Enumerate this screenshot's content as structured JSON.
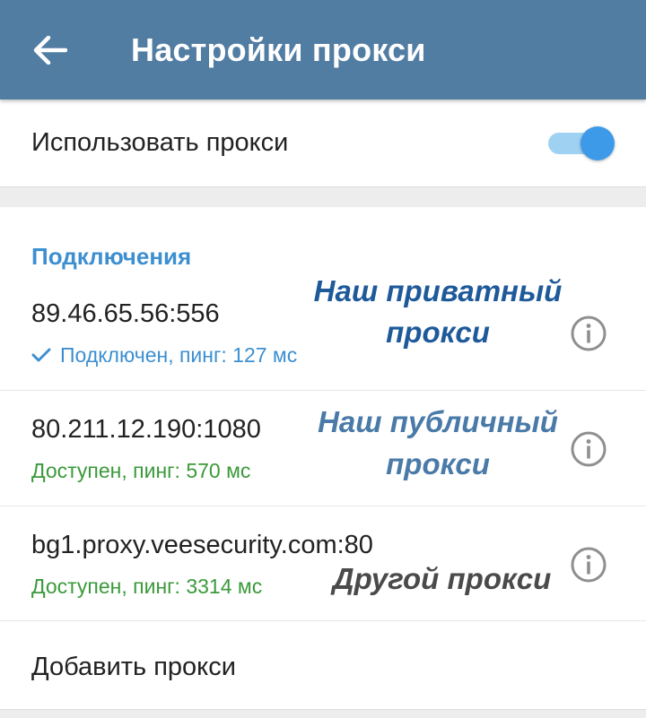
{
  "appbar": {
    "title": "Настройки прокси",
    "back_icon": "arrow-left-icon"
  },
  "use_proxy": {
    "label": "Использовать прокси",
    "enabled": true
  },
  "connections": {
    "header": "Подключения",
    "items": [
      {
        "address": "89.46.65.56:556",
        "status": "Подключен, пинг: 127 мс",
        "status_color": "#3d8fd0",
        "connected": true
      },
      {
        "address": "80.211.12.190:1080",
        "status": "Доступен, пинг: 570 мс",
        "status_color": "#3a9a3a",
        "connected": false
      },
      {
        "address": "bg1.proxy.veesecurity.com:80",
        "status": "Доступен, пинг: 3314 мс",
        "status_color": "#3a9a3a",
        "connected": false
      }
    ],
    "add_label": "Добавить прокси"
  },
  "annotations": {
    "private_line1": "Наш приватный",
    "private_line2": "прокси",
    "public_line1": "Наш публичный",
    "public_line2": "прокси",
    "other": "Другой прокси"
  },
  "colors": {
    "appbar": "#527da3",
    "accent": "#3d8fd0",
    "available": "#3a9a3a",
    "toggle": "#3d9ae8"
  }
}
